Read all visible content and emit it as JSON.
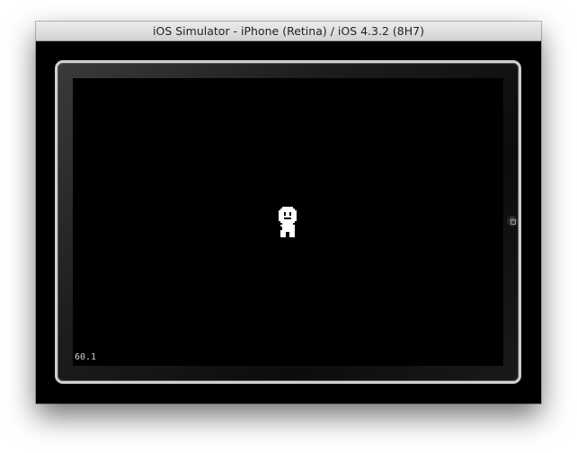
{
  "window": {
    "title": "iOS Simulator - iPhone (Retina) / iOS 4.3.2 (8H7)"
  },
  "game": {
    "fps_counter": "60.1",
    "sprite": "pixel-character-sprite"
  },
  "device": {
    "home_button_icon": "home-button-icon"
  },
  "colors": {
    "screen_background": "#000000",
    "bezel_border": "#cfcfcf",
    "sprite_color": "#ffffff",
    "titlebar_text": "#222222"
  }
}
